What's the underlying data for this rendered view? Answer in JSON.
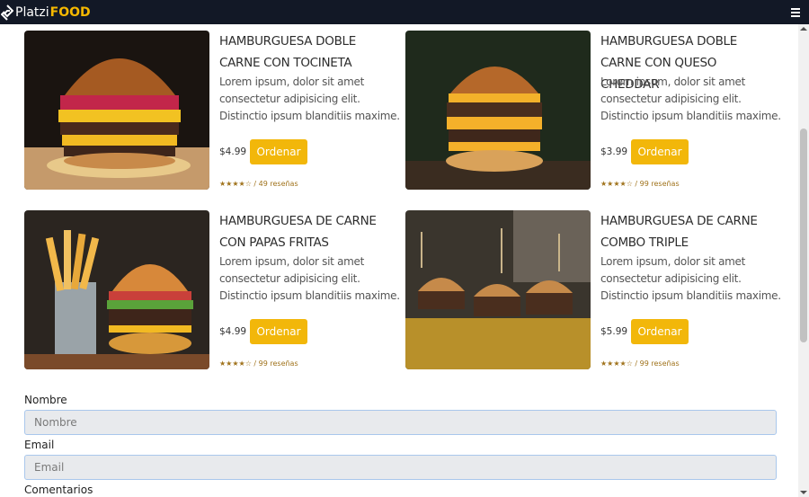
{
  "brand": {
    "platzi": "Platzi",
    "food": "FOOD",
    "accent": "#f5b800"
  },
  "nav": {
    "menu_icon": "hamburger-menu-icon"
  },
  "products": [
    {
      "title": "HAMBURGUESA DOBLE CARNE CON TOCINETA",
      "description": "Lorem ipsum, dolor sit amet consectetur adipisicing elit. Distinctio ipsum blanditiis maxime.",
      "price": "$4.99",
      "button": "Ordenar",
      "rating": "★★★★☆ / 49 reseñas"
    },
    {
      "title": "HAMBURGUESA DOBLE CARNE CON QUESO CHEDDAR",
      "description": "Lorem ipsum, dolor sit amet consectetur adipisicing elit. Distinctio ipsum blanditiis maxime.",
      "price": "$3.99",
      "button": "Ordenar",
      "rating": "★★★★☆ / 99 reseñas"
    },
    {
      "title": "HAMBURGUESA DE CARNE CON PAPAS FRITAS",
      "description": "Lorem ipsum, dolor sit amet consectetur adipisicing elit. Distinctio ipsum blanditiis maxime.",
      "price": "$4.99",
      "button": "Ordenar",
      "rating": "★★★★☆ / 99 reseñas"
    },
    {
      "title": "HAMBURGUESA DE CARNE COMBO TRIPLE",
      "description": "Lorem ipsum, dolor sit amet consectetur adipisicing elit. Distinctio ipsum blanditiis maxime.",
      "price": "$5.99",
      "button": "Ordenar",
      "rating": "★★★★☆ / 99 reseñas"
    }
  ],
  "form": {
    "name_label": "Nombre",
    "name_placeholder": "Nombre",
    "email_label": "Email",
    "email_placeholder": "Email",
    "comments_label": "Comentarios"
  },
  "colors": {
    "navbar": "#121826",
    "button": "#f2b70a",
    "rating": "#a0731c"
  }
}
